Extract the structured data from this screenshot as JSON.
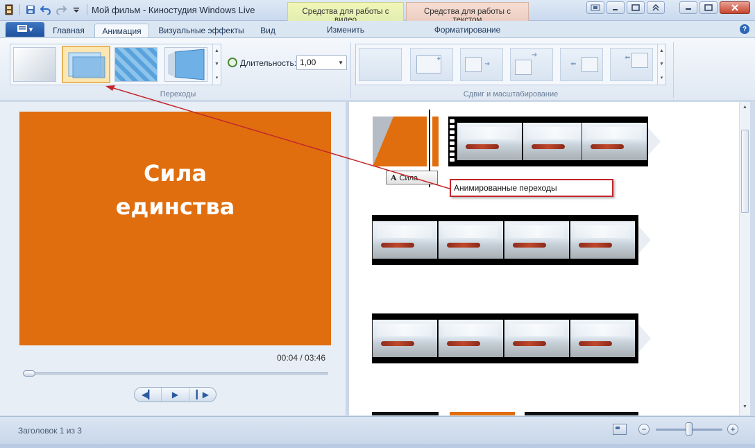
{
  "window": {
    "title": "Мой фильм - Киностудия Windows Live",
    "context_tabs": {
      "video_tools": "Средства для работы с видео",
      "text_tools": "Средства для работы с текстом"
    },
    "context_subtabs": {
      "edit": "Изменить",
      "format": "Форматирование"
    }
  },
  "qat": {
    "icons": [
      "app-icon",
      "save-icon",
      "undo-icon",
      "redo-icon",
      "customize-icon"
    ]
  },
  "ribbon": {
    "tabs": [
      "Главная",
      "Анимация",
      "Визуальные эффекты",
      "Вид"
    ],
    "active_tab": "Анимация",
    "transitions_group_label": "Переходы",
    "duration_label": "Длительность:",
    "duration_value": "1,00",
    "pan_zoom_group_label": "Сдвиг и масштабирование"
  },
  "preview": {
    "title_line1": "Сила",
    "title_line2": "единства",
    "timecode": "00:04 / 03:46",
    "seek_position": 0.0
  },
  "storyboard": {
    "caption_chip": "Сила",
    "callout_text": "Анимированные переходы"
  },
  "statusbar": {
    "text": "Заголовок 1 из 3",
    "zoom_level": 0.5
  },
  "colors": {
    "title_clip": "#e06e0e",
    "callout_border": "#c4262c"
  }
}
